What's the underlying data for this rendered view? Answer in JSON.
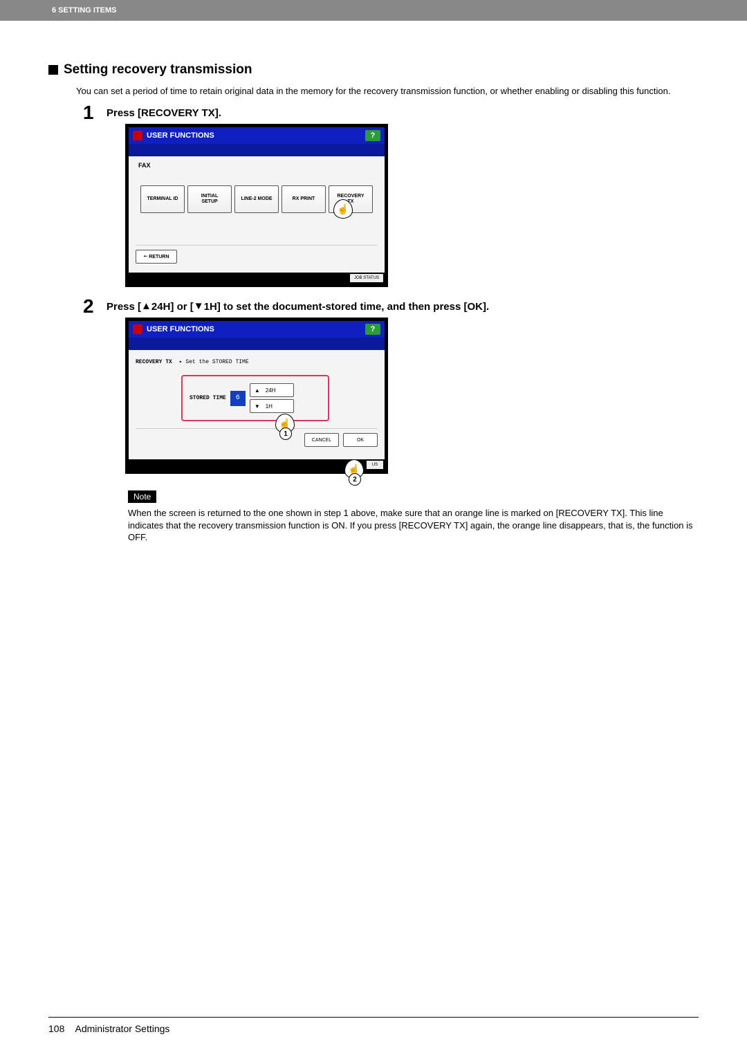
{
  "header": {
    "chapter": "6 SETTING ITEMS"
  },
  "section": {
    "title": "Setting recovery transmission",
    "intro": "You can set a period of time to retain original data in the memory for the recovery transmission function, or whether enabling or disabling this function."
  },
  "steps": {
    "s1": {
      "num": "1",
      "text": "Press [RECOVERY TX]."
    },
    "s2": {
      "num": "2",
      "text_prefix": "Press [",
      "up_sym": "▲",
      "up_txt": "24H] or [",
      "dn_sym": "▼",
      "dn_txt": "1H] to set the document-stored time, and then press [OK]."
    }
  },
  "panel1": {
    "title": "USER FUNCTIONS",
    "help": "?",
    "tab": "FAX",
    "buttons": {
      "b1": "TERMINAL ID",
      "b2": "INITIAL\nSETUP",
      "b3": "LINE-2 MODE",
      "b4": "RX PRINT",
      "b5": "RECOVERY\nTX"
    },
    "return": "RETURN",
    "jobstatus": "JOB STATUS"
  },
  "panel2": {
    "title": "USER FUNCTIONS",
    "help": "?",
    "left": "RECOVERY TX",
    "prompt": "▸ Set the STORED TIME",
    "stored_label": "STORED TIME",
    "stored_value": "6",
    "up": "24H",
    "down": "1H",
    "cancel": "CANCEL",
    "ok": "OK",
    "us": "US",
    "badge1": "1",
    "badge2": "2"
  },
  "note": {
    "label": "Note",
    "text": "When the screen is returned to the one shown in step 1 above, make sure that an orange line is marked on [RECOVERY TX]. This line indicates that the recovery transmission function is ON. If you press [RECOVERY TX] again, the orange line disappears, that is, the function is OFF."
  },
  "footer": {
    "page": "108",
    "section": "Administrator Settings"
  }
}
